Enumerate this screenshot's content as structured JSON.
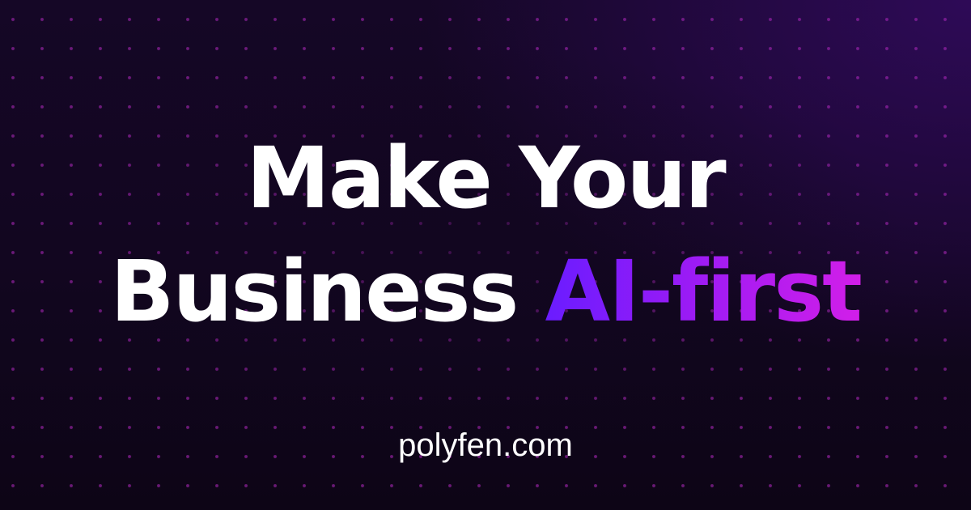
{
  "headline": {
    "line1": "Make Your",
    "line2_prefix": "Business",
    "line2_accent": "AI-first"
  },
  "site": {
    "domain": "polyfen.com"
  },
  "colors": {
    "background": "#120620",
    "glow": "#2e0a57",
    "dot": "#b028be",
    "accent_start": "#6a1cff",
    "accent_end": "#d21ee9",
    "text": "#ffffff"
  }
}
